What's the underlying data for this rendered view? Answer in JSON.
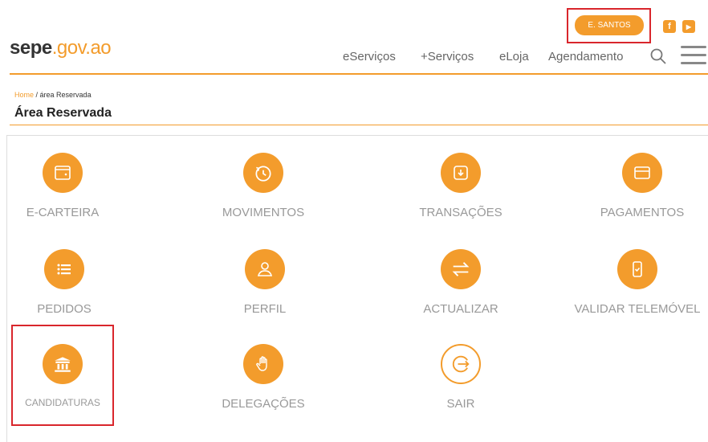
{
  "header": {
    "user_button": "E. SANTOS",
    "logo_main": "sepe",
    "logo_domain": ".gov.ao",
    "nav": [
      "eServiços",
      "+Serviços",
      "eLoja",
      "Agendamento"
    ],
    "social": {
      "facebook": "f",
      "youtube": "▶"
    }
  },
  "breadcrumb": {
    "home": "Home",
    "separator": " / ",
    "current": "área Reservada"
  },
  "page_title": "Área Reservada",
  "tiles": [
    {
      "label": "E-CARTEIRA",
      "icon": "wallet-icon"
    },
    {
      "label": "MOVIMENTOS",
      "icon": "clock-history-icon"
    },
    {
      "label": "TRANSAÇÕES",
      "icon": "download-box-icon"
    },
    {
      "label": "PAGAMENTOS",
      "icon": "card-icon"
    },
    {
      "label": "PEDIDOS",
      "icon": "list-icon"
    },
    {
      "label": "PERFIL",
      "icon": "user-icon"
    },
    {
      "label": "ACTUALIZAR",
      "icon": "swap-arrows-icon"
    },
    {
      "label": "VALIDAR TELEMÓVEL",
      "icon": "phone-check-icon"
    },
    {
      "label": "CANDIDATURAS",
      "icon": "institution-icon"
    },
    {
      "label": "DELEGAÇÕES",
      "icon": "hand-icon"
    },
    {
      "label": "SAIR",
      "icon": "exit-icon"
    }
  ],
  "colors": {
    "accent": "#f39c2c",
    "highlight": "#d9262c"
  }
}
